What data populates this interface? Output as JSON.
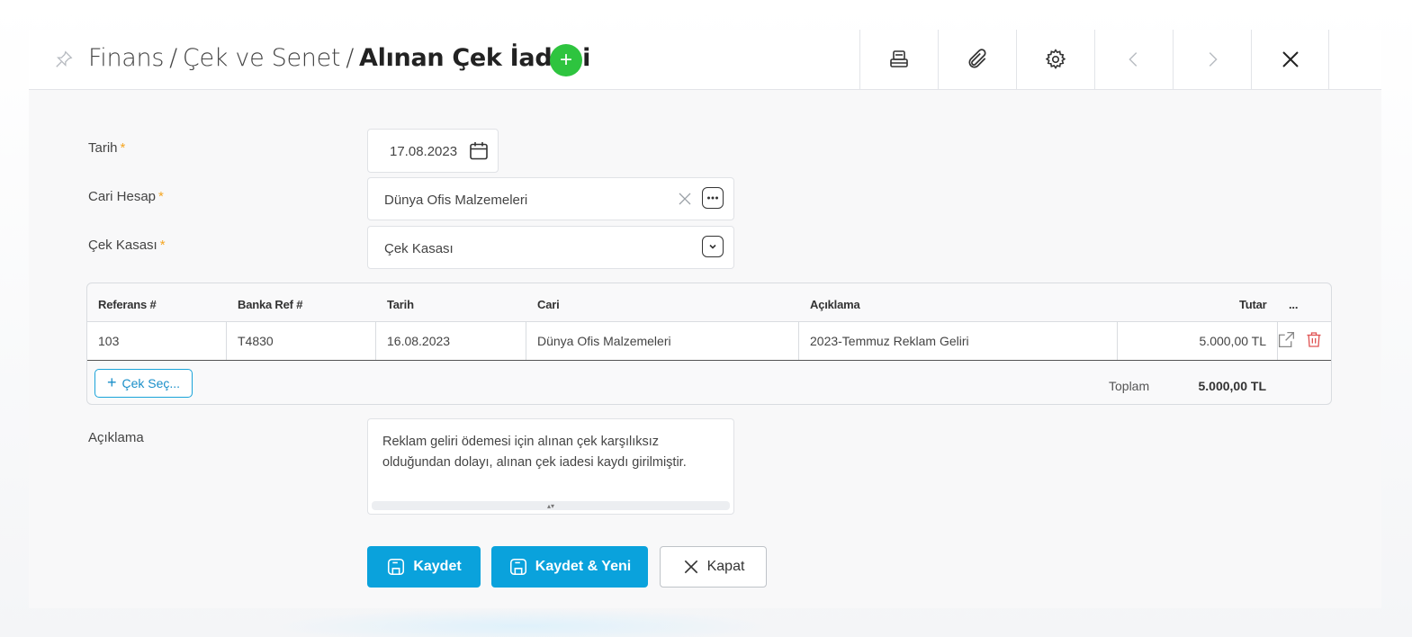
{
  "header": {
    "breadcrumb": [
      "Finans",
      "Çek ve Senet"
    ],
    "separator": "/",
    "title": "Alınan Çek İadesi",
    "add_symbol": "+"
  },
  "toolbar": {
    "icons": [
      "pin-icon",
      "print-icon",
      "attachment-icon",
      "settings-icon",
      "chevron-left-icon",
      "chevron-right-icon",
      "close-icon"
    ]
  },
  "form": {
    "tarih": {
      "label": "Tarih",
      "required": "*",
      "value": "17.08.2023"
    },
    "cari": {
      "label": "Cari Hesap",
      "required": "*",
      "value": "Dünya Ofis Malzemeleri"
    },
    "kasa": {
      "label": "Çek Kasası",
      "required": "*",
      "value": "Çek Kasası"
    },
    "aciklama": {
      "label": "Açıklama",
      "value": "Reklam geliri ödemesi için alınan çek karşılıksız olduğundan dolayı, alınan çek iadesi kaydı girilmiştir."
    }
  },
  "grid": {
    "columns": [
      "Referans #",
      "Banka Ref #",
      "Tarih",
      "Cari",
      "Açıklama",
      "Tutar",
      "..."
    ],
    "rows": [
      {
        "referans": "103",
        "banka_ref": "T4830",
        "tarih": "16.08.2023",
        "cari": "Dünya Ofis Malzemeleri",
        "aciklama": "2023-Temmuz Reklam Geliri",
        "tutar": "5.000,00 TL"
      }
    ],
    "add_button": "Çek Seç...",
    "total_label": "Toplam",
    "total_value": "5.000,00 TL"
  },
  "actions": {
    "save": "Kaydet",
    "save_new": "Kaydet & Yeni",
    "close": "Kapat"
  },
  "colors": {
    "primary": "#0aa2dc",
    "add_green": "#2ec43f",
    "required": "#f5a623",
    "delete": "#e05555"
  }
}
